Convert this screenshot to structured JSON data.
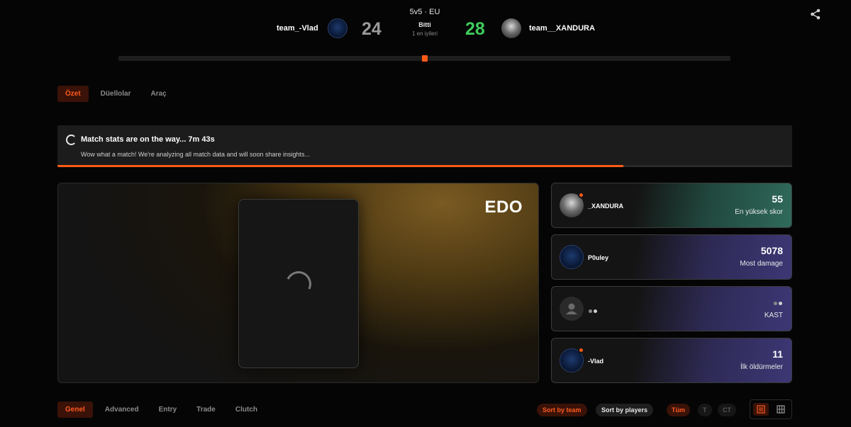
{
  "match": {
    "mode": "5v5 · EU",
    "status": "Bitti",
    "format": "1 en iyileri",
    "team1": {
      "name": "team_-Vlad",
      "score": "24"
    },
    "team2": {
      "name": "team__XANDURA",
      "score": "28"
    }
  },
  "tabs": [
    {
      "label": "Özet",
      "active": true
    },
    {
      "label": "Düellolar",
      "active": false
    },
    {
      "label": "Araç",
      "active": false
    }
  ],
  "banner": {
    "title": "Match stats are on the way... 7m 43s",
    "subtitle": "Wow what a match! We're analyzing all match data and will soon share insights...",
    "progress": 0.77
  },
  "mvp": {
    "name": "EDO"
  },
  "stats": [
    {
      "player": "_XANDURA",
      "value": "55",
      "label": "En yüksek skor"
    },
    {
      "player": "P0uley",
      "value": "5078",
      "label": "Most damage"
    },
    {
      "player": "",
      "value": "",
      "label": "KAST"
    },
    {
      "player": "-Vlad",
      "value": "11",
      "label": "İlk öldürmeler"
    }
  ],
  "bottom_tabs": [
    {
      "label": "Genel",
      "active": true
    },
    {
      "label": "Advanced",
      "active": false
    },
    {
      "label": "Entry",
      "active": false
    },
    {
      "label": "Trade",
      "active": false
    },
    {
      "label": "Clutch",
      "active": false
    }
  ],
  "sort": {
    "by_team": "Sort by team",
    "by_players": "Sort by players"
  },
  "sides": {
    "all": "Tüm",
    "t": "T",
    "ct": "CT"
  },
  "colors": {
    "accent": "#ff5a16",
    "win_score": "#3fcb5b",
    "lose_score": "#9a9a9a"
  },
  "icons": {
    "share": "share-icon",
    "list_view": "list-view-icon",
    "grid_view": "grid-view-icon"
  }
}
